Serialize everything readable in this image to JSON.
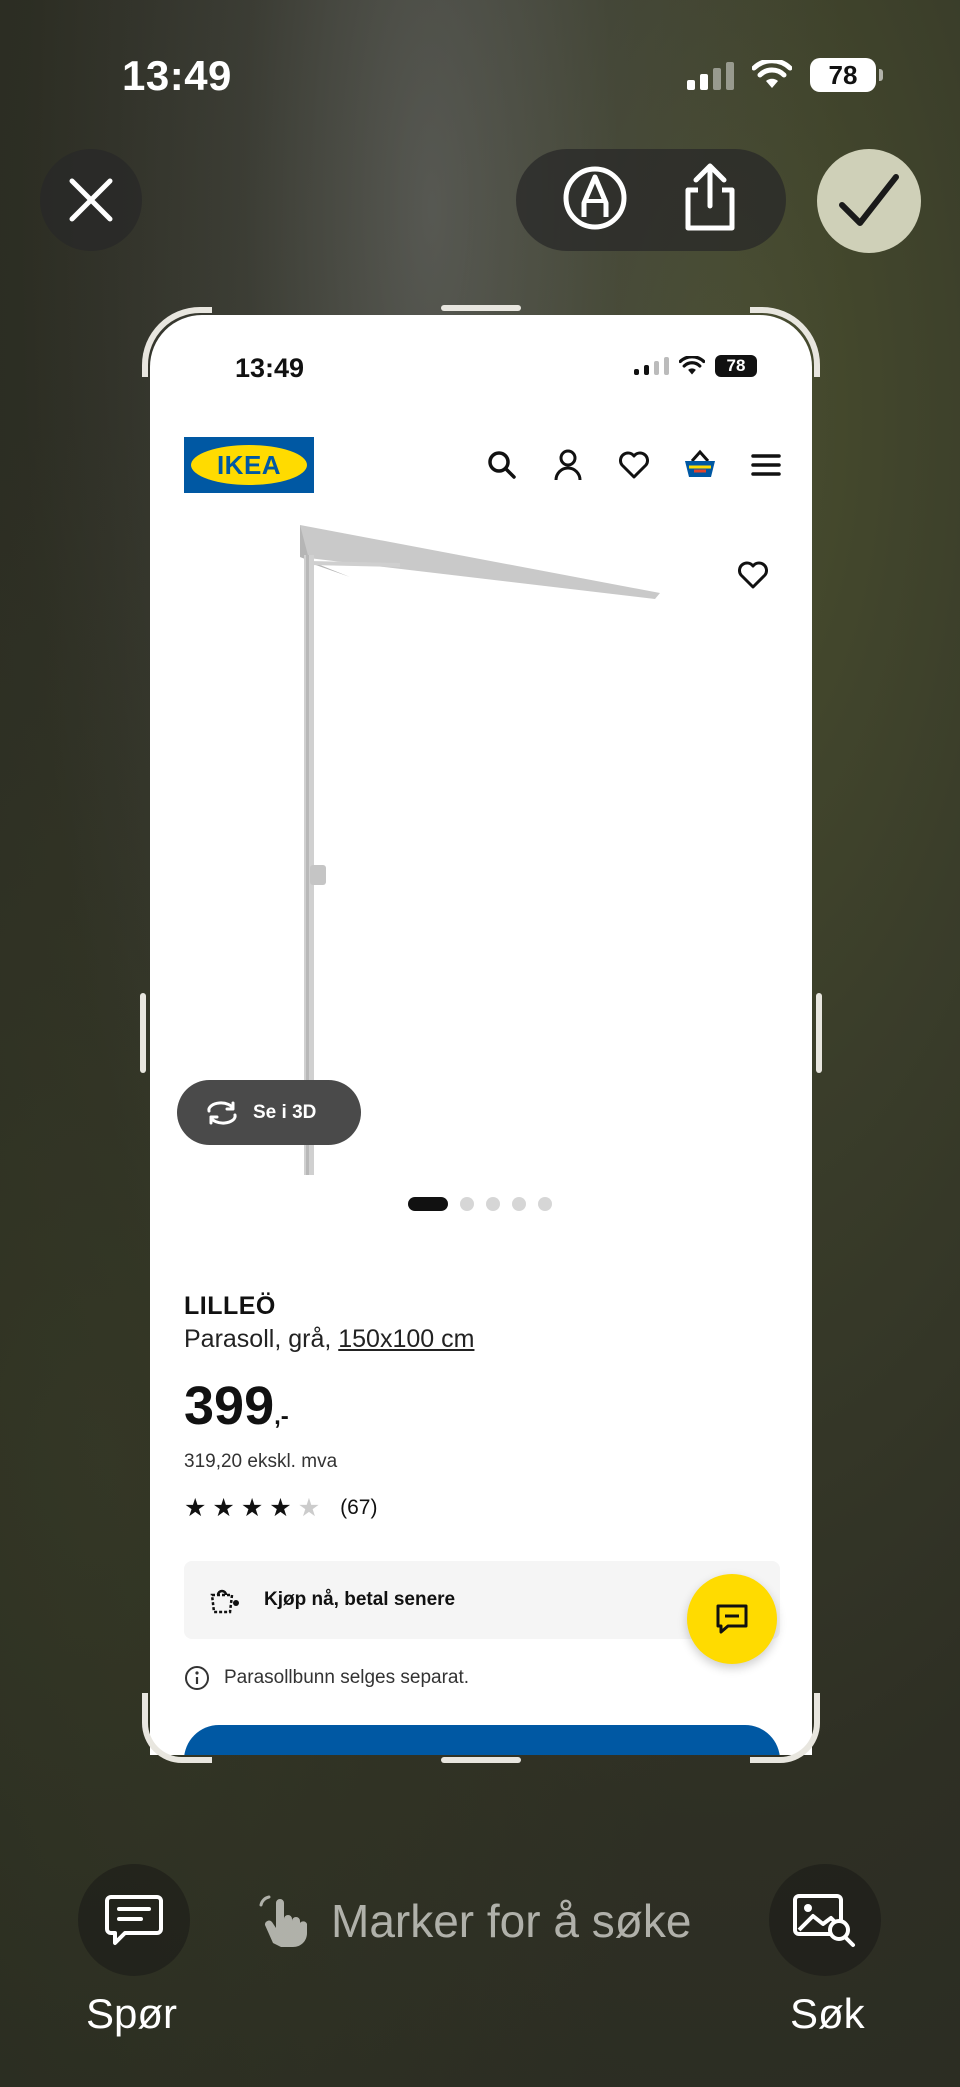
{
  "system_status": {
    "time": "13:49",
    "battery": "78"
  },
  "toolbar": {
    "close_icon": "close-icon",
    "markup_icon": "markup-pen-icon",
    "share_icon": "share-icon",
    "done_icon": "checkmark-icon"
  },
  "screenshot": {
    "status": {
      "time": "13:49",
      "battery": "78"
    },
    "header": {
      "logo_text": "IKEA",
      "icons": [
        "search-icon",
        "account-icon",
        "wishlist-icon",
        "cart-icon",
        "menu-icon"
      ]
    },
    "product": {
      "view3d_label": "Se i 3D",
      "image_dots": 5,
      "active_dot": 0,
      "name": "LILLEÖ",
      "desc_prefix": "Parasoll, grå, ",
      "size": "150x100 cm",
      "price": "399",
      "price_suffix": ",-",
      "price_ex_vat": "319,20 ekskl. mva",
      "rating_value": 4,
      "rating_max": 5,
      "rating_count": "(67)",
      "klarna_text": "Kjøp nå, betal senere",
      "info_text": "Parasollbunn selges separat."
    },
    "colors": {
      "ikea_blue": "#0058a3",
      "ikea_yellow": "#ffdb00"
    }
  },
  "bottom": {
    "ask_label": "Spør",
    "hint": "Marker for å søke",
    "search_label": "Søk"
  }
}
